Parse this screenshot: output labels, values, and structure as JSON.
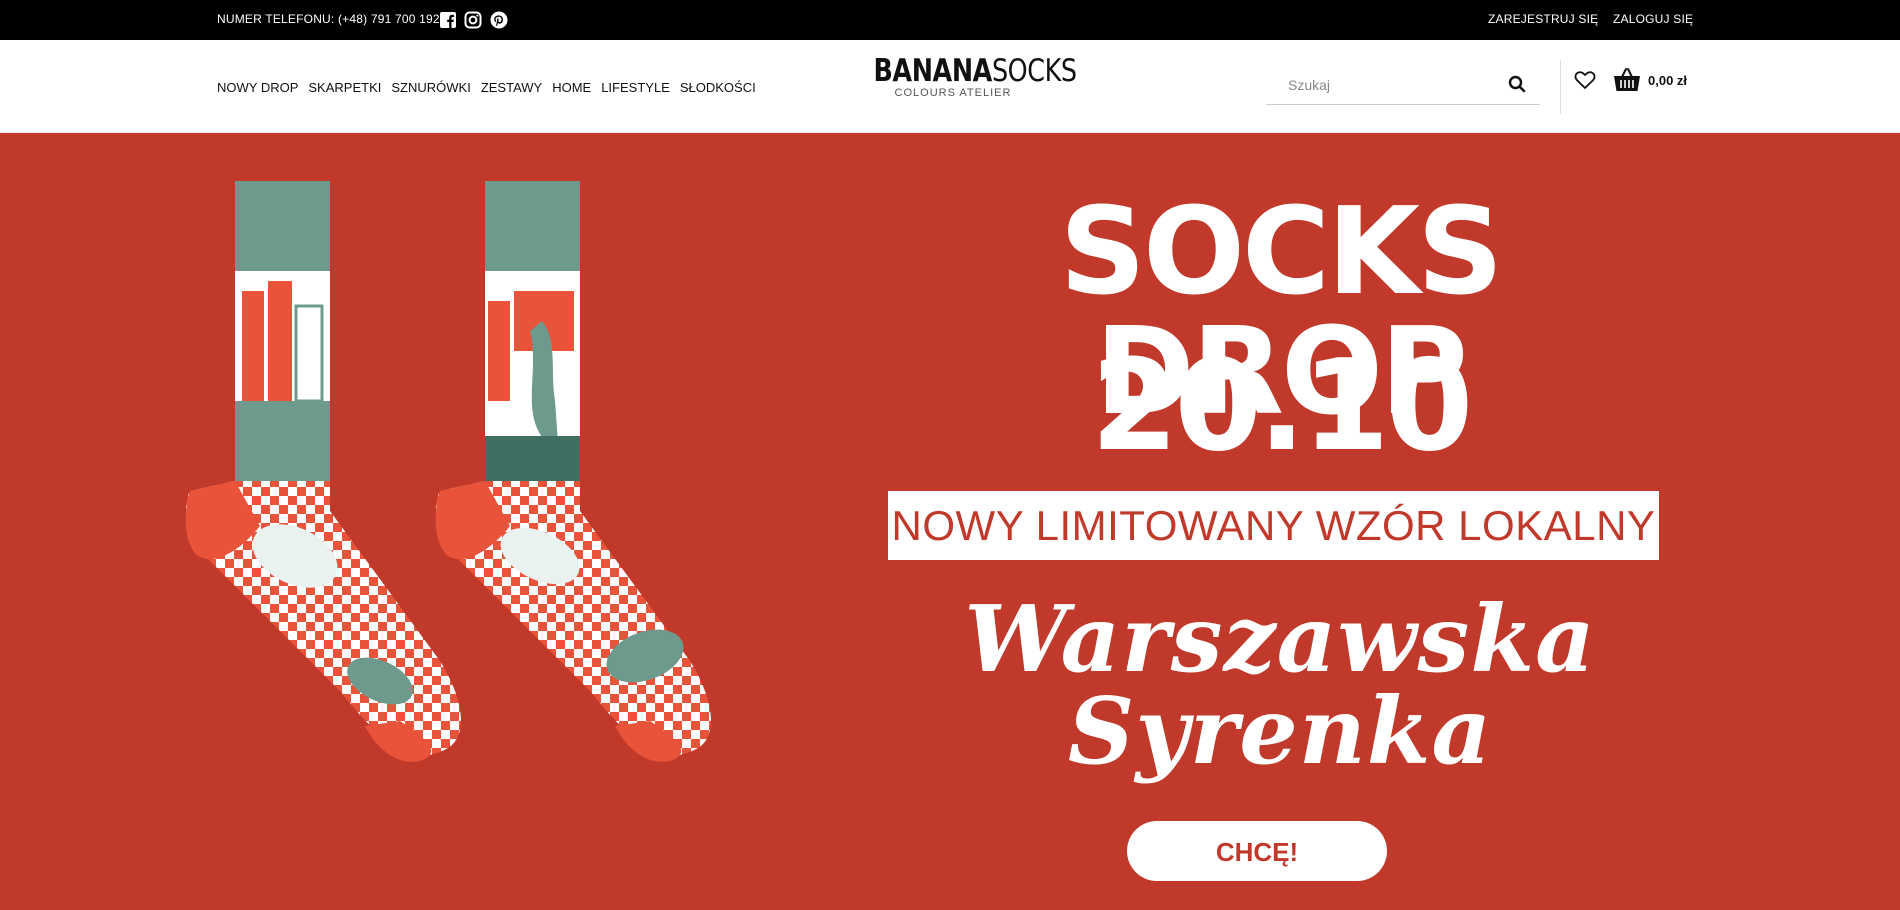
{
  "topbar": {
    "phone": "NUMER TELEFONU: (+48) 791 700 192",
    "social_icons": [
      "facebook-icon",
      "instagram-icon",
      "pinterest-icon"
    ],
    "register": "ZAREJESTRUJ SIĘ",
    "login": "ZALOGUJ SIĘ"
  },
  "nav": {
    "items": [
      "NOWY DROP",
      "SKARPETKI",
      "SZNURÓWKI",
      "ZESTAWY",
      "HOME",
      "LIFESTYLE",
      "SŁODKOŚCI"
    ]
  },
  "logo": {
    "bold": "BANANA",
    "thin": "SOCKS",
    "subtitle": "COLOURS ATELIER"
  },
  "search": {
    "placeholder": "Szukaj"
  },
  "cart": {
    "total": "0,00 zł"
  },
  "hero": {
    "headline_1": "SOCKS DROP",
    "headline_2": "20.10",
    "tagline": "NOWY LIMITOWANY WZÓR LOKALNY",
    "script_line_1": "Warszawska",
    "script_line_2": "Syrenka",
    "cta": "CHCĘ!"
  },
  "colors": {
    "hero_bg": "#c0392b",
    "sock_green": "#6d9a8c",
    "sock_orange": "#e25a36"
  }
}
